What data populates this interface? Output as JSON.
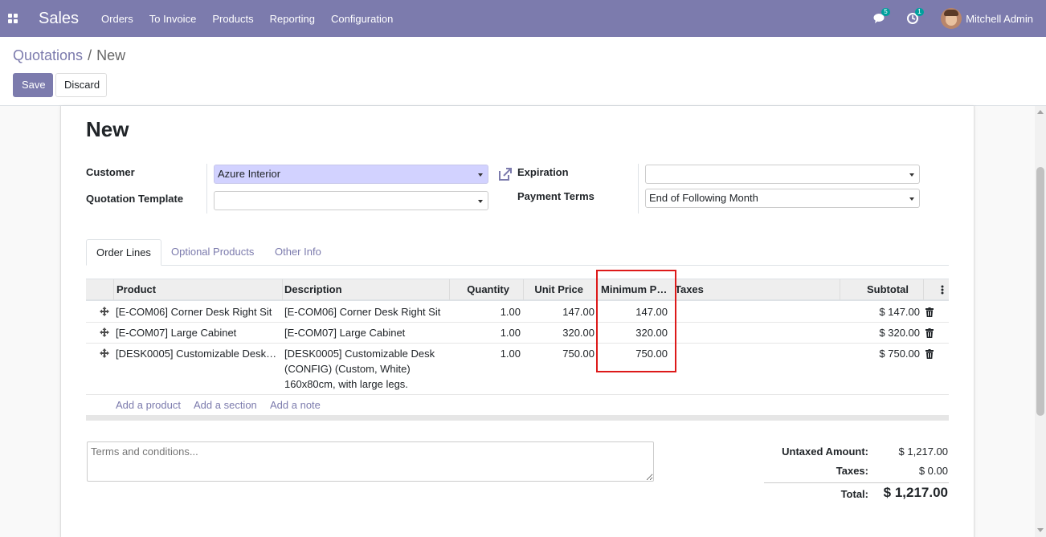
{
  "navbar": {
    "app_name": "Sales",
    "menu": [
      "Orders",
      "To Invoice",
      "Products",
      "Reporting",
      "Configuration"
    ],
    "messages_count": "5",
    "activities_count": "1",
    "user_name": "Mitchell Admin",
    "color": "#7c7bad"
  },
  "breadcrumb": {
    "parent": "Quotations",
    "separator": "/",
    "current": "New"
  },
  "actions": {
    "save_label": "Save",
    "discard_label": "Discard"
  },
  "form": {
    "title": "New",
    "customer_label": "Customer",
    "customer_value": "Azure Interior",
    "template_label": "Quotation Template",
    "template_value": "",
    "expiration_label": "Expiration",
    "expiration_value": "",
    "payment_terms_label": "Payment Terms",
    "payment_terms_value": "End of Following Month"
  },
  "tabs": [
    "Order Lines",
    "Optional Products",
    "Other Info"
  ],
  "table": {
    "headers": {
      "product": "Product",
      "description": "Description",
      "quantity": "Quantity",
      "unit_price": "Unit Price",
      "minimum_price": "Minimum P…",
      "taxes": "Taxes",
      "subtotal": "Subtotal"
    },
    "rows": [
      {
        "product": "[E-COM06] Corner Desk Right Sit",
        "description": [
          "[E-COM06] Corner Desk Right Sit"
        ],
        "quantity": "1.00",
        "unit_price": "147.00",
        "minimum_price": "147.00",
        "taxes": "",
        "subtotal": "$ 147.00"
      },
      {
        "product": "[E-COM07] Large Cabinet",
        "description": [
          "[E-COM07] Large Cabinet"
        ],
        "quantity": "1.00",
        "unit_price": "320.00",
        "minimum_price": "320.00",
        "taxes": "",
        "subtotal": "$ 320.00"
      },
      {
        "product": "[DESK0005] Customizable Desk…",
        "description": [
          "[DESK0005] Customizable Desk",
          "(CONFIG) (Custom, White)",
          "160x80cm, with large legs."
        ],
        "quantity": "1.00",
        "unit_price": "750.00",
        "minimum_price": "750.00",
        "taxes": "",
        "subtotal": "$ 750.00"
      }
    ],
    "add_product": "Add a product",
    "add_section": "Add a section",
    "add_note": "Add a note"
  },
  "terms_placeholder": "Terms and conditions...",
  "totals": {
    "untaxed_label": "Untaxed Amount:",
    "untaxed_value": "$ 1,217.00",
    "taxes_label": "Taxes:",
    "taxes_value": "$ 0.00",
    "total_label": "Total:",
    "total_value": "$ 1,217.00"
  },
  "highlight_color": "#dd1a1a"
}
